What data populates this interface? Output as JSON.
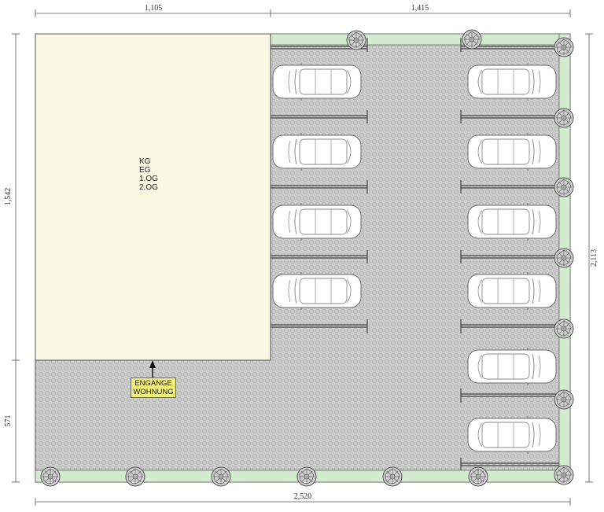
{
  "dimensions": {
    "top_left": "1,105",
    "top_right": "1,415",
    "left_upper": "1,542",
    "left_lower": "571",
    "right": "2,113",
    "bottom": "2,520"
  },
  "building": {
    "floors": [
      "KG",
      "EG",
      "1.OG",
      "2.OG"
    ]
  },
  "entrance": {
    "line1": "ENGANGE",
    "line2": "WOHNUNG"
  },
  "colors": {
    "building_fill": "#fbf9e3",
    "paving": "#c9c9c9",
    "green_strip": "#d3ebcf",
    "entrance_tag": "#f5f07a"
  },
  "icons": {
    "car": "car-icon",
    "tree": "tree-icon",
    "entrance_arrow": "arrow-up-icon"
  }
}
